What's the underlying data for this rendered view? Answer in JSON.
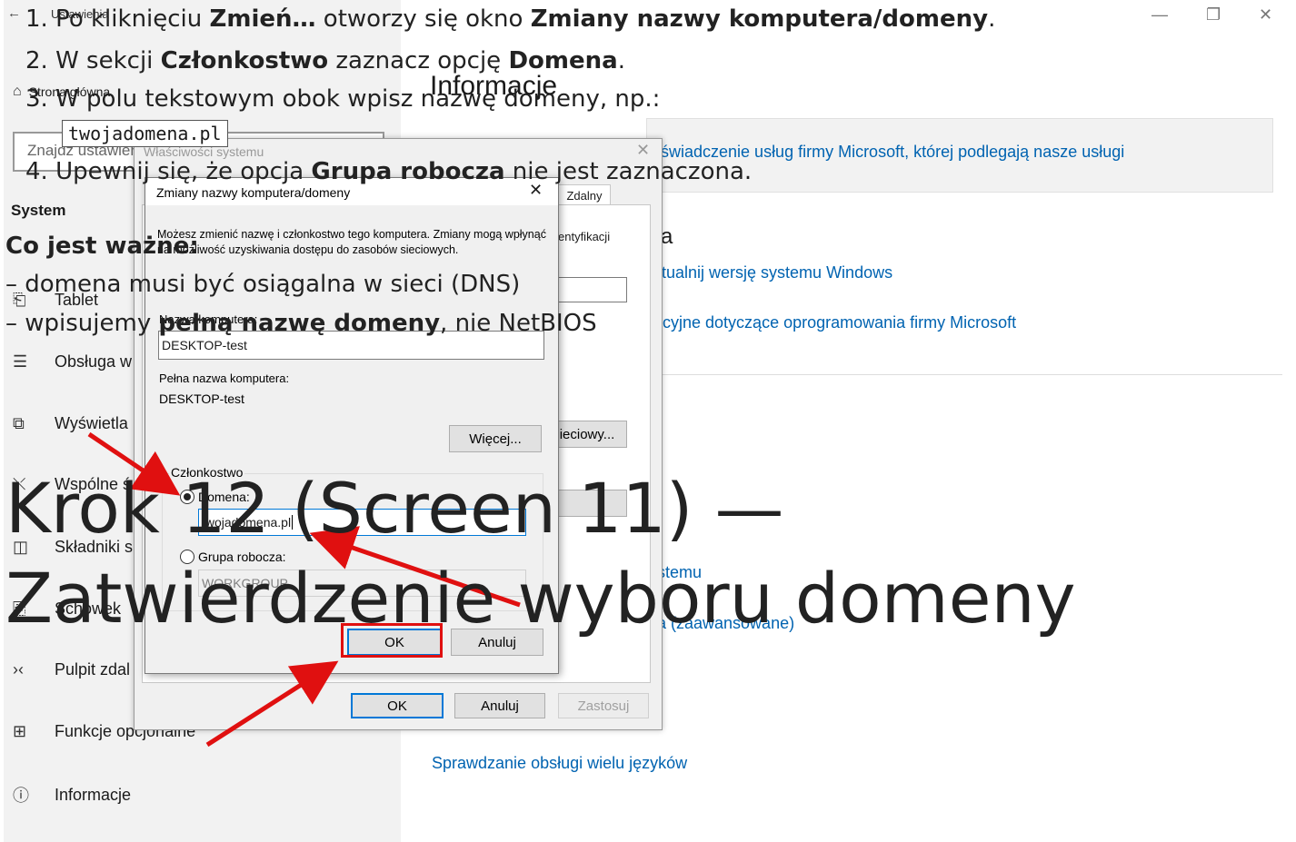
{
  "window": {
    "app_title": "Ustawienia",
    "min": "—",
    "restore": "❐",
    "close": "✕"
  },
  "left": {
    "home": "Strona główna",
    "search_placeholder": "Znajdź ustawienie",
    "section": "System",
    "items": [
      {
        "icon": "tablet-icon",
        "glyph": "⎗",
        "label": "Tablet"
      },
      {
        "icon": "maintenance-icon",
        "glyph": "☰",
        "label": "Obsługa w"
      },
      {
        "icon": "display-icon",
        "glyph": "⧉",
        "label": "Wyświetla"
      },
      {
        "icon": "share-icon",
        "glyph": "⤬",
        "label": "Wspólne ś"
      },
      {
        "icon": "components-icon",
        "glyph": "◫",
        "label": "Składniki s"
      },
      {
        "icon": "clipboard-icon",
        "glyph": "⎘",
        "label": "Schowek"
      },
      {
        "icon": "remote-desktop-icon",
        "glyph": "›‹",
        "label": "Pulpit zdal"
      },
      {
        "icon": "optional-features-icon",
        "glyph": "⊞",
        "label": "Funkcje opcjonalne"
      },
      {
        "icon": "info-icon",
        "glyph": "ⓘ",
        "label": "Informacje"
      }
    ]
  },
  "right": {
    "heading": "Informacje",
    "banner": "świadczenie usług firmy Microsoft, której podlegają nasze usługi",
    "fragment_a": "a",
    "link1": "ktualnij wersję systemu Windows",
    "link2": "ncyjne dotyczące oprogramowania firmy Microsoft",
    "link3": "stemu",
    "link4": "a (zaawansowane)",
    "link5": "Sprawdzanie obsługi wielu języków"
  },
  "sysprops": {
    "title": "Właściwości systemu",
    "tab_remote": "Zdalny",
    "ident_frag": "entyfikacji",
    "network_btn": "ieciowy...",
    "ok": "OK",
    "cancel": "Anuluj",
    "apply": "Zastosuj"
  },
  "dialog": {
    "title": "Zmiany nazwy komputera/domeny",
    "desc": "Możesz zmienić nazwę i członkostwo tego komputera. Zmiany mogą wpłynąć na możliwość uzyskiwania dostępu do zasobów sieciowych.",
    "name_label": "Nazwa komputera:",
    "name_value": "DESKTOP-test",
    "fullname_label": "Pełna nazwa komputera:",
    "fullname_value": "DESKTOP-test",
    "more_btn": "Więcej...",
    "membership": "Członkostwo",
    "domain_label": "Domena:",
    "domain_value": "twojadomena.pl",
    "workgroup_label": "Grupa robocza:",
    "workgroup_value": "WORKGROUP",
    "ok": "OK",
    "cancel": "Anuluj"
  },
  "overlay": {
    "step1_pre": "Po kliknięciu ",
    "step1_b1": "Zmień…",
    "step1_mid": " otworzy się okno ",
    "step1_b2": "Zmiany nazwy komputera/domeny",
    "step1_end": ".",
    "step2_pre": "W sekcji ",
    "step2_b1": "Członkostwo",
    "step2_mid": " zaznacz opcję ",
    "step2_b2": "Domena",
    "step2_end": ".",
    "step3": "W polu tekstowym obok wpisz nazwę domeny, np.:",
    "code": "twojadomena.pl",
    "step4_pre": "Upewnij się, że opcja ",
    "step4_b": "Grupa robocza",
    "step4_end": " nie jest zaznaczona.",
    "important": "Co jest ważne:",
    "note1": "– domena musi być osiągalna w sieci (DNS)",
    "note2_pre": "– wpisujemy ",
    "note2_b": "pełną nazwę domeny",
    "note2_end": ", nie NetBIOS",
    "big_title_1": "Krok 12 (Screen 11) —",
    "big_title_2": "Zatwierdzenie wyboru domeny"
  },
  "colors": {
    "accent": "#0078d7",
    "link": "#0063b1",
    "arrow": "#e01010"
  }
}
